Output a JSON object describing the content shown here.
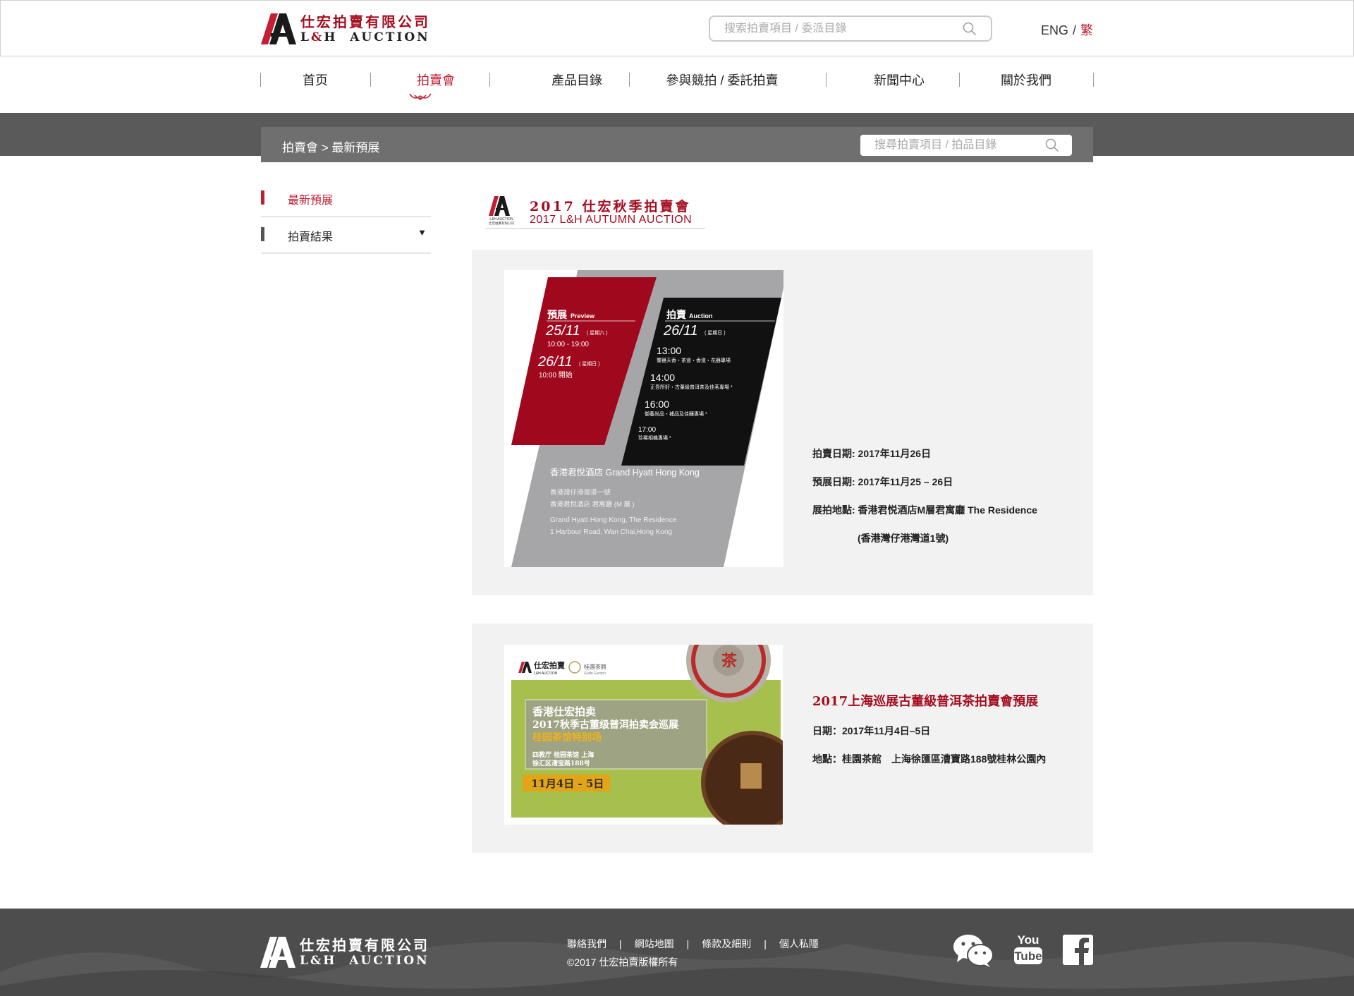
{
  "header": {
    "brand_cn": "仕宏拍賣有限公司",
    "brand_en_pre": "L",
    "brand_en_amp": "&",
    "brand_en_post": "H  AUCTION",
    "search_placeholder": "搜索拍賣項目 / 委派目錄",
    "lang_eng": "ENG",
    "lang_sep": "/",
    "lang_trad": "繁"
  },
  "nav": {
    "items": [
      {
        "label": "首页"
      },
      {
        "label": "拍賣會",
        "active": true
      },
      {
        "label": "產品目錄"
      },
      {
        "label": "參與競拍 / 委託拍賣"
      },
      {
        "label": "新聞中心"
      },
      {
        "label": "關於我們"
      }
    ]
  },
  "breadcrumb": {
    "text": "拍賣會 > 最新預展",
    "search_placeholder": "搜尋拍賣項目 / 拍品目錄"
  },
  "sidebar": {
    "items": [
      {
        "label": "最新預展",
        "active": true
      },
      {
        "label": "拍賣結果",
        "arrow": "▼"
      }
    ]
  },
  "section": {
    "title_cn": "2017 仕宏秋季拍賣會",
    "title_en": "2017 L&H AUTUMN AUCTION",
    "logo_sub_en": "L&H AUCTION",
    "logo_sub_cn": "仕宏拍賣有限公司"
  },
  "auction1": {
    "poster": {
      "preview_label": "預展",
      "preview_label_en": "Preview",
      "preview_date1": "25/11",
      "preview_day1": "( 星期六 )",
      "preview_time1": "10:00 - 19:00",
      "preview_date2": "26/11",
      "preview_day2": "( 星期日 )",
      "preview_time2": "10:00 開始",
      "auction_label": "拍賣",
      "auction_label_en": "Auction",
      "auction_date": "26/11",
      "auction_day": "( 星期日 )",
      "sessions": [
        {
          "time": "13:00",
          "desc": "饗器天香・茶道・香道・花器專場"
        },
        {
          "time": "14:00",
          "desc": "正吾所好・古董級普洱茶及佳茗專場 *"
        },
        {
          "time": "16:00",
          "desc": "御養尚品・補品及佳釀專場 *"
        },
        {
          "time": "17:00",
          "desc": "珍稀相機專場 *"
        }
      ],
      "venue_title": "香港君悅酒店 Grand Hyatt Hong Kong",
      "venue_cn1": "香港灣仔港灣道一號",
      "venue_cn2": "香港君悅酒店 君寓廳 (M 層 )",
      "venue_en1": "Grand Hyatt Hong Kong, The Residence",
      "venue_en2": "1 Harbour Road, Wan Chai,Hong Kong"
    },
    "info": {
      "date": "拍賣日期: 2017年11月26日",
      "preview": "預展日期: 2017年11月25 – 26日",
      "venue": "展拍地點: 香港君悦酒店M層君寓廳 The Residence",
      "address": "(香港灣仔港灣道1號)"
    }
  },
  "auction2": {
    "poster": {
      "brand": "仕宏拍賣",
      "brand_en": "L&H AUCTION",
      "partner": "桂園茶館",
      "partner_en": "Guilin Garden",
      "line1": "香港仕宏拍卖",
      "line2": "2017秋季古董级普洱拍卖会巡展",
      "line3": "桂园茶馆特别场",
      "place1": "四教厅 桂园茶馆 上海",
      "place2": "徐汇区漕宝路188号",
      "dates": "11月4日 - 5日"
    },
    "info": {
      "title": "2017上海巡展古董級普洱茶拍賣會預展",
      "date": "日期：2017年11月4日–5日",
      "venue": "地點：桂園茶館　上海徐匯區漕寶路188號桂林公園內"
    }
  },
  "footer": {
    "brand_cn": "仕宏拍賣有限公司",
    "brand_en": "L&H  AUCTION",
    "links": [
      "聯絡我們",
      "網站地圖",
      "條款及細則",
      "個人私隱"
    ],
    "divider": "|",
    "copyright": "©2017 仕宏拍賣版權所有",
    "social_youtube_top": "You",
    "social_youtube_bottom": "Tube"
  },
  "colors": {
    "brand_red": "#a50d1f",
    "accent_red": "#c21f32",
    "banner_gray": "#5a5a5a",
    "footer_gray": "#4d4d4d"
  },
  "icons": [
    "logo-mark",
    "search-icon",
    "nav-ornament-icon",
    "wechat-icon",
    "youtube-icon",
    "facebook-icon"
  ]
}
